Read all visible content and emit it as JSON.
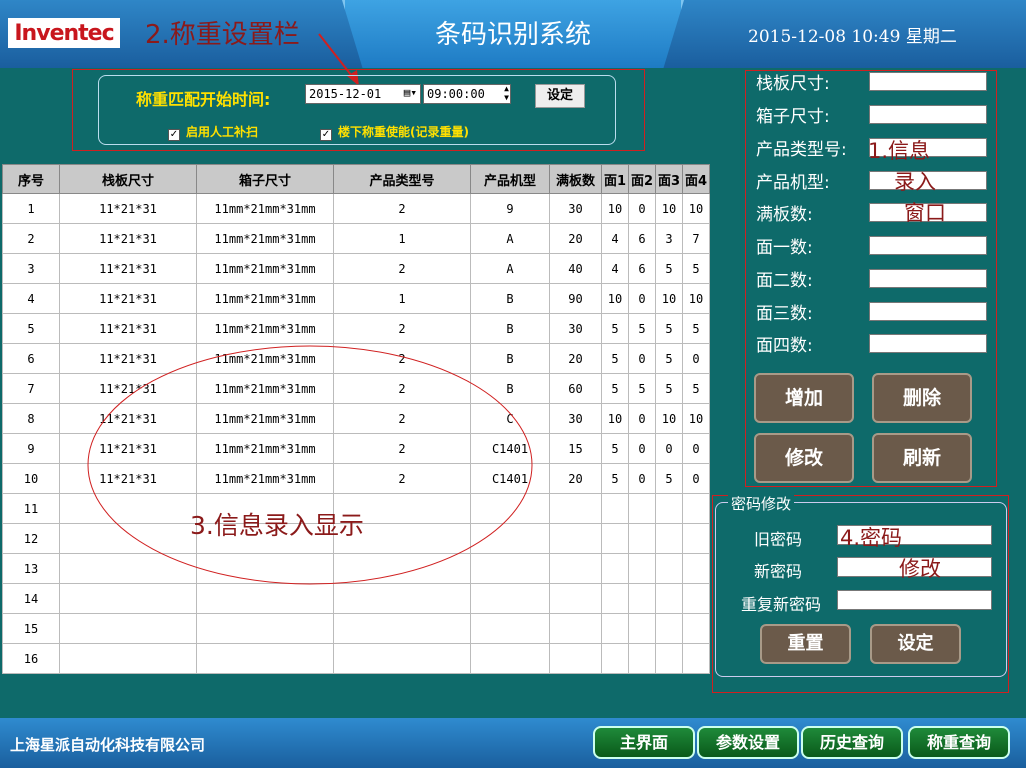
{
  "header": {
    "logo": "Inventec",
    "title": "条码识别系统",
    "datetime": "2015-12-08  10:49   星期二"
  },
  "annotations": {
    "weight_bar": "2.称重设置栏",
    "info_window": [
      "1.信息",
      "录入",
      "窗口"
    ],
    "table_area": "3.信息录入显示",
    "password": [
      "4.密码",
      "修改"
    ]
  },
  "weight": {
    "label": "称重匹配开始时间:",
    "date": "2015-12-01",
    "time": "09:00:00",
    "set_label": "设定",
    "check1": "启用人工补扫",
    "check2": "楼下称重使能(记录重量)"
  },
  "table": {
    "headers": [
      "序号",
      "栈板尺寸",
      "箱子尺寸",
      "产品类型号",
      "产品机型",
      "满板数",
      "面1",
      "面2",
      "面3",
      "面4"
    ],
    "rows": [
      [
        "1",
        "11*21*31",
        "11mm*21mm*31mm",
        "2",
        "9",
        "30",
        "10",
        "0",
        "10",
        "10"
      ],
      [
        "2",
        "11*21*31",
        "11mm*21mm*31mm",
        "1",
        "A",
        "20",
        "4",
        "6",
        "3",
        "7"
      ],
      [
        "3",
        "11*21*31",
        "11mm*21mm*31mm",
        "2",
        "A",
        "40",
        "4",
        "6",
        "5",
        "5"
      ],
      [
        "4",
        "11*21*31",
        "11mm*21mm*31mm",
        "1",
        "B",
        "90",
        "10",
        "0",
        "10",
        "10"
      ],
      [
        "5",
        "11*21*31",
        "11mm*21mm*31mm",
        "2",
        "B",
        "30",
        "5",
        "5",
        "5",
        "5"
      ],
      [
        "6",
        "11*21*31",
        "11mm*21mm*31mm",
        "2",
        "B",
        "20",
        "5",
        "0",
        "5",
        "0"
      ],
      [
        "7",
        "11*21*31",
        "11mm*21mm*31mm",
        "2",
        "B",
        "60",
        "5",
        "5",
        "5",
        "5"
      ],
      [
        "8",
        "11*21*31",
        "11mm*21mm*31mm",
        "2",
        "C",
        "30",
        "10",
        "0",
        "10",
        "10"
      ],
      [
        "9",
        "11*21*31",
        "11mm*21mm*31mm",
        "2",
        "C1401",
        "15",
        "5",
        "0",
        "0",
        "0"
      ],
      [
        "10",
        "11*21*31",
        "11mm*21mm*31mm",
        "2",
        "C1401",
        "20",
        "5",
        "0",
        "5",
        "0"
      ],
      [
        "11",
        "",
        "",
        "",
        "",
        "",
        "",
        "",
        "",
        ""
      ],
      [
        "12",
        "",
        "",
        "",
        "",
        "",
        "",
        "",
        "",
        ""
      ],
      [
        "13",
        "",
        "",
        "",
        "",
        "",
        "",
        "",
        "",
        ""
      ],
      [
        "14",
        "",
        "",
        "",
        "",
        "",
        "",
        "",
        "",
        ""
      ],
      [
        "15",
        "",
        "",
        "",
        "",
        "",
        "",
        "",
        "",
        ""
      ],
      [
        "16",
        "",
        "",
        "",
        "",
        "",
        "",
        "",
        "",
        ""
      ]
    ]
  },
  "info": {
    "labels": [
      "栈板尺寸:",
      "箱子尺寸:",
      "产品类型号:",
      "产品机型:",
      "满板数:",
      "面一数:",
      "面二数:",
      "面三数:",
      "面四数:"
    ],
    "add": "增加",
    "delete": "删除",
    "modify": "修改",
    "refresh": "刷新"
  },
  "password": {
    "title": "密码修改",
    "old": "旧密码",
    "new": "新密码",
    "repeat": "重复新密码",
    "reset": "重置",
    "set": "设定"
  },
  "footer": {
    "company": "上海星派自动化科技有限公司",
    "nav": [
      "主界面",
      "参数设置",
      "历史查询",
      "称重查询"
    ]
  },
  "chart_data": {
    "type": "table",
    "columns": [
      "序号",
      "栈板尺寸",
      "箱子尺寸",
      "产品类型号",
      "产品机型",
      "满板数",
      "面1",
      "面2",
      "面3",
      "面4"
    ],
    "rows": [
      [
        "1",
        "11*21*31",
        "11mm*21mm*31mm",
        "2",
        "9",
        "30",
        "10",
        "0",
        "10",
        "10"
      ],
      [
        "2",
        "11*21*31",
        "11mm*21mm*31mm",
        "1",
        "A",
        "20",
        "4",
        "6",
        "3",
        "7"
      ],
      [
        "3",
        "11*21*31",
        "11mm*21mm*31mm",
        "2",
        "A",
        "40",
        "4",
        "6",
        "5",
        "5"
      ],
      [
        "4",
        "11*21*31",
        "11mm*21mm*31mm",
        "1",
        "B",
        "90",
        "10",
        "0",
        "10",
        "10"
      ],
      [
        "5",
        "11*21*31",
        "11mm*21mm*31mm",
        "2",
        "B",
        "30",
        "5",
        "5",
        "5",
        "5"
      ],
      [
        "6",
        "11*21*31",
        "11mm*21mm*31mm",
        "2",
        "B",
        "20",
        "5",
        "0",
        "5",
        "0"
      ],
      [
        "7",
        "11*21*31",
        "11mm*21mm*31mm",
        "2",
        "B",
        "60",
        "5",
        "5",
        "5",
        "5"
      ],
      [
        "8",
        "11*21*31",
        "11mm*21mm*31mm",
        "2",
        "C",
        "30",
        "10",
        "0",
        "10",
        "10"
      ],
      [
        "9",
        "11*21*31",
        "11mm*21mm*31mm",
        "2",
        "C1401",
        "15",
        "5",
        "0",
        "0",
        "0"
      ],
      [
        "10",
        "11*21*31",
        "11mm*21mm*31mm",
        "2",
        "C1401",
        "20",
        "5",
        "0",
        "5",
        "0"
      ]
    ]
  }
}
